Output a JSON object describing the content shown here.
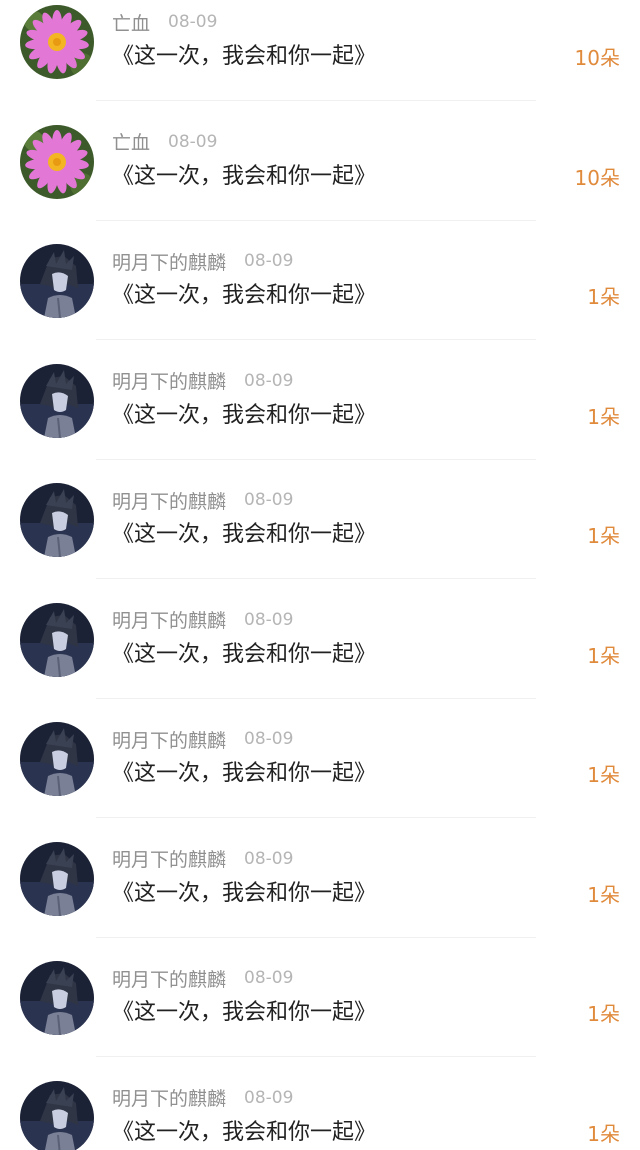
{
  "accent_color": "#e08a3c",
  "rows": [
    {
      "avatar": "pink-daisy-avatar",
      "username": "亡血",
      "date": "08-09",
      "title": "《这一次，我会和你一起》",
      "count": "10朵"
    },
    {
      "avatar": "pink-daisy-avatar",
      "username": "亡血",
      "date": "08-09",
      "title": "《这一次，我会和你一起》",
      "count": "10朵"
    },
    {
      "avatar": "anime-boy-avatar",
      "username": "明月下的麒麟",
      "date": "08-09",
      "title": "《这一次，我会和你一起》",
      "count": "1朵"
    },
    {
      "avatar": "anime-boy-avatar",
      "username": "明月下的麒麟",
      "date": "08-09",
      "title": "《这一次，我会和你一起》",
      "count": "1朵"
    },
    {
      "avatar": "anime-boy-avatar",
      "username": "明月下的麒麟",
      "date": "08-09",
      "title": "《这一次，我会和你一起》",
      "count": "1朵"
    },
    {
      "avatar": "anime-boy-avatar",
      "username": "明月下的麒麟",
      "date": "08-09",
      "title": "《这一次，我会和你一起》",
      "count": "1朵"
    },
    {
      "avatar": "anime-boy-avatar",
      "username": "明月下的麒麟",
      "date": "08-09",
      "title": "《这一次，我会和你一起》",
      "count": "1朵"
    },
    {
      "avatar": "anime-boy-avatar",
      "username": "明月下的麒麟",
      "date": "08-09",
      "title": "《这一次，我会和你一起》",
      "count": "1朵"
    },
    {
      "avatar": "anime-boy-avatar",
      "username": "明月下的麒麟",
      "date": "08-09",
      "title": "《这一次，我会和你一起》",
      "count": "1朵"
    },
    {
      "avatar": "anime-boy-avatar",
      "username": "明月下的麒麟",
      "date": "08-09",
      "title": "《这一次，我会和你一起》",
      "count": "1朵"
    }
  ]
}
